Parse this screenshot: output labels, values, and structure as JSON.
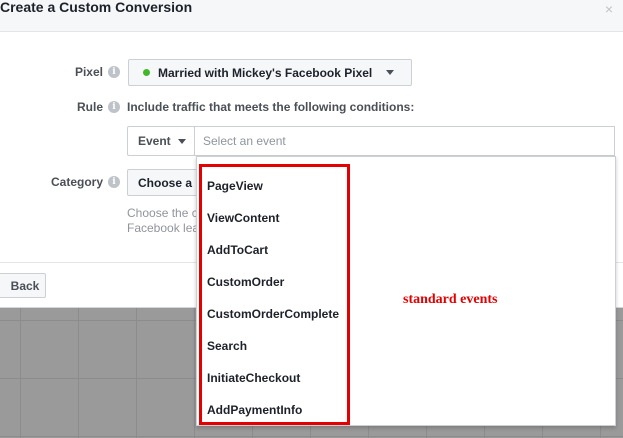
{
  "dialog": {
    "title": "Create a Custom Conversion",
    "close_icon": "×"
  },
  "pixel": {
    "label": "Pixel",
    "selected": "Married with Mickey's Facebook Pixel",
    "status_color": "#42b72a"
  },
  "rule": {
    "label": "Rule",
    "description": "Include traffic that meets the following conditions:",
    "type_selector": "Event",
    "event_placeholder": "Select an event"
  },
  "category": {
    "label": "Category",
    "selector": "Choose a",
    "helper_line1": "Choose the c",
    "helper_line2": "Facebook lea"
  },
  "dropdown": {
    "events": [
      "PageView",
      "ViewContent",
      "AddToCart",
      "CustomOrder",
      "CustomOrderComplete",
      "Search",
      "InitiateCheckout",
      "AddPaymentInfo"
    ]
  },
  "annotation": {
    "text": "standard events",
    "color": "#e40000"
  },
  "footer": {
    "back_label": "Back"
  },
  "icons": {
    "info": "info-icon",
    "close": "close-icon",
    "caret": "chevron-down-icon"
  }
}
